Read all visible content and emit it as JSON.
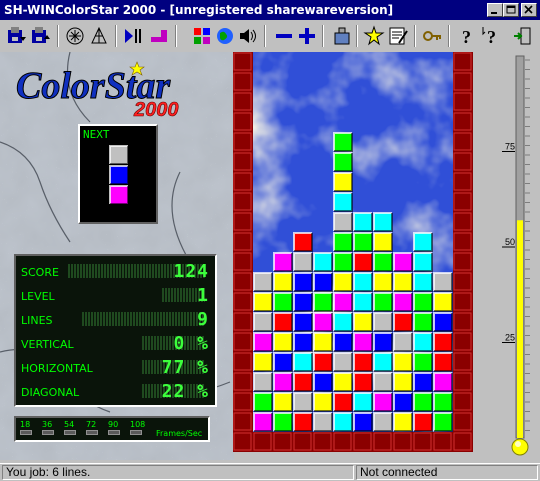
{
  "window": {
    "title": "SH-WINColorStar 2000 - [unregistered sharewareversion]"
  },
  "caption_buttons": [
    "minimize",
    "maximize",
    "close"
  ],
  "toolbar": {
    "buttons": [
      {
        "name": "open-game-icon"
      },
      {
        "name": "save-game-icon"
      },
      {
        "name": "options-icon"
      },
      {
        "name": "network-icon"
      },
      {
        "name": "play-pause-icon"
      },
      {
        "name": "piece-icon"
      },
      {
        "name": "grid-icon"
      },
      {
        "name": "globe-icon"
      },
      {
        "name": "sound-icon"
      },
      {
        "name": "decrease-icon"
      },
      {
        "name": "increase-icon"
      },
      {
        "name": "highscore-icon"
      },
      {
        "name": "star-icon"
      },
      {
        "name": "edit-icon"
      },
      {
        "name": "key-icon"
      },
      {
        "name": "help-icon"
      },
      {
        "name": "context-help-icon"
      },
      {
        "name": "exit-icon"
      }
    ]
  },
  "logo": {
    "line1": "ColorStar",
    "line2": "2000"
  },
  "next": {
    "label": "NEXT",
    "colors": [
      "#c0c0c0",
      "#0000ff",
      "#ff00ff"
    ]
  },
  "stats": [
    {
      "label": "SCORE",
      "value": "124"
    },
    {
      "label": "LEVEL",
      "value": "1"
    },
    {
      "label": "LINES",
      "value": "9"
    },
    {
      "label": "VERTICAL",
      "value": "0 %"
    },
    {
      "label": "HORIZONTAL",
      "value": "77 %"
    },
    {
      "label": "DIAGONAL",
      "value": "22 %"
    }
  ],
  "fps": {
    "values": [
      "18",
      "36",
      "54",
      "72",
      "90",
      "108"
    ],
    "unit": "Frames/Sec"
  },
  "board": {
    "cols": 10,
    "rows": 19,
    "palette": {
      "R": "#ff0000",
      "G": "#00ff00",
      "B": "#0000ff",
      "Y": "#ffff00",
      "M": "#ff00ff",
      "C": "#00ffff",
      "S": "#c0c0c0"
    },
    "falling": {
      "col": 4,
      "row": 4,
      "colors": [
        "G",
        "G",
        "Y"
      ]
    },
    "grid": [
      "..........",
      "..........",
      "..........",
      "..........",
      "..........",
      "..........",
      "..........",
      "....C.....",
      "....SCC...",
      "..R.GGY.C.",
      ".MSCGRGMC.",
      "SYBBYCYYCS",
      "YGBGMCGMGY",
      "SRBMCYSRGB",
      "MYBYBMBSCR",
      "YBCRSRCYGR",
      "SMRBYRSYBM",
      "GYSYRCMBGG",
      "MGRSCBSYRG"
    ]
  },
  "meter": {
    "ticks": [
      "75",
      "50",
      "25"
    ],
    "level_percent": 57
  },
  "status": {
    "left": "You job:  6 lines.",
    "right": "Not connected"
  },
  "colors": {
    "titlebar": "#000080",
    "brick": "#8b0000",
    "lcd": "#00ff00"
  }
}
